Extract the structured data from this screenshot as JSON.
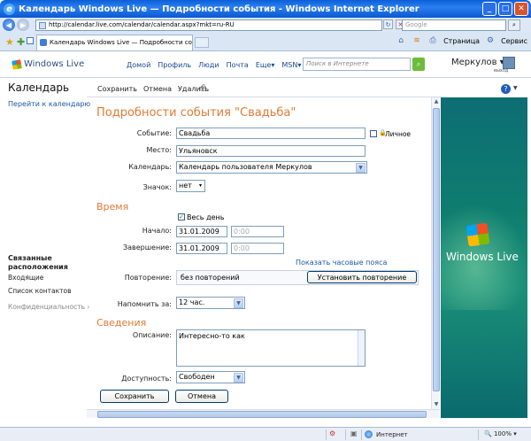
{
  "browser": {
    "title": "Календарь Windows Live — Подробности события - Windows Internet Explorer",
    "url": "http://calendar.live.com/calendar/calendar.aspx?mkt=ru-RU",
    "search_placeholder": "Google",
    "tab_title": "Календарь Windows Live — Подробности события",
    "cmd_page": "Страница",
    "cmd_service": "Сервис"
  },
  "wl_header": {
    "logo": "Windows Live",
    "nav": [
      "Домой",
      "Профиль",
      "Люди",
      "Почта",
      "Еще▾",
      "MSN▾"
    ],
    "search_placeholder": "Поиск в Интернете",
    "user": "Меркулов ▾",
    "exit": "выход"
  },
  "sidebar": {
    "title": "Календарь",
    "goto": "Перейти к календарю",
    "related_heading": "Связанные расположения",
    "links": [
      "Входящие",
      "Список контактов",
      "Конфиденциальность ›"
    ]
  },
  "toolbar": {
    "save": "Сохранить",
    "cancel": "Отмена",
    "delete": "Удалить"
  },
  "form": {
    "heading": "Подробности события \"Свадьба\"",
    "event_label": "Событие:",
    "event_value": "Свадьба",
    "private_label": "Личное",
    "place_label": "Место:",
    "place_value": "Ульяновск",
    "calendar_label": "Календарь:",
    "calendar_value": "Календарь пользователя Меркулов",
    "icon_label": "Значок:",
    "icon_value": "нет",
    "time_section": "Время",
    "allday_label": "Весь день",
    "start_label": "Начало:",
    "start_date": "31.01.2009",
    "start_time": "0:00",
    "end_label": "Завершение:",
    "end_date": "31.01.2009",
    "end_time": "0:00",
    "show_timezones": "Показать часовые пояса",
    "repeat_label": "Повторение:",
    "repeat_value": "без повторений",
    "set_repeat_button": "Установить повторение",
    "remind_label": "Напомнить за:",
    "remind_value": "12 час.",
    "info_section": "Сведения",
    "desc_label": "Описание:",
    "desc_value": "Интересно-то как",
    "avail_label": "Доступность:",
    "avail_value": "Свободен",
    "save_button": "Сохранить",
    "cancel_button": "Отмена"
  },
  "ad": {
    "text": "Windows Live"
  },
  "status": {
    "zone": "Интернет",
    "zoom": "100%"
  }
}
